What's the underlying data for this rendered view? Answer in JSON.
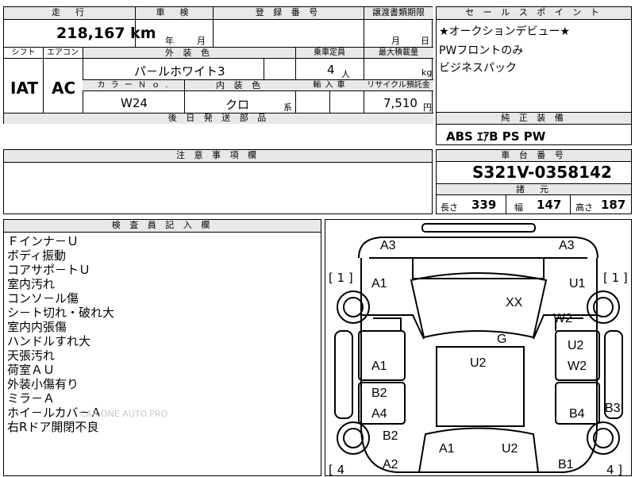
{
  "top_table": {
    "mileage_label": "走　行",
    "mileage_value": "218,167 km",
    "inspection_label": "車　検",
    "inspection_year_label": "年",
    "inspection_month_label": "月",
    "registration_label": "登 録 番 号",
    "transfer_deadline_label": "譲渡書類期限",
    "transfer_month_label": "月",
    "transfer_day_label": "日",
    "shift_label": "シフト",
    "shift_value": "IAT",
    "aircon_label": "エアコン",
    "aircon_value": "AC",
    "exterior_color_label": "外 装 色",
    "exterior_color_value": "パ－ルホワイト3",
    "capacity_label": "乗車定員",
    "capacity_value": "4",
    "capacity_unit": "人",
    "max_load_label": "最大積載量",
    "max_load_unit": "kg",
    "color_no_label": "カ ラ ー Ｎ ｏ .",
    "color_no_value": "W24",
    "interior_color_label": "内 装 色",
    "interior_color_value": "クロ",
    "interior_suffix": "系",
    "import_label": "輸 入 車",
    "recycle_label": "リサイクル預託金",
    "recycle_value": "7,510",
    "recycle_unit": "円",
    "later_parts_label": "後 日 発 送 部 品"
  },
  "sales_points": {
    "title": "セ ー ル ス ポ イ ン ト",
    "lines": [
      "★オークションデビュー★",
      "PWフロントのみ",
      "ビジネスパック"
    ]
  },
  "genuine_equipment": {
    "title": "純 正 装 備",
    "value": "ABS ｴｱB PS PW"
  },
  "notes": {
    "title": "注 意 事 項 欄"
  },
  "chassis": {
    "title": "車 台 番 号",
    "value": "S321V-0358142",
    "spec_title": "諸　元",
    "length_label": "長さ",
    "length_value": "339",
    "width_label": "幅",
    "width_value": "147",
    "height_label": "高さ",
    "height_value": "187"
  },
  "inspector": {
    "title": "検 査 員 記 入 欄",
    "lines": [
      "Ｆインナ－Ｕ",
      "ボディ振動",
      "コアサポ－トＵ",
      "室内汚れ",
      "コンソ－ル傷",
      "シ－ト切れ・破れ大",
      "室内内張傷",
      "ハンドルすれ大",
      "天張汚れ",
      "荷室ＡＵ",
      "外装小傷有り",
      "ミラ－Ａ",
      "ホイ－ルカバ－Ａ",
      "右Rドア開閉不良"
    ],
    "watermark": "CAR.ONE AUTO.PRO"
  },
  "diagram": {
    "tire_left": "[ 1 ]",
    "tire_right": "[ 1 ]",
    "tire_left_bottom": "[ 4",
    "tire_right_bottom": "4 ]",
    "codes": {
      "a3_left": "A3",
      "a3_right": "A3",
      "a1_left_top": "A1",
      "u1_right": "U1",
      "xx": "XX",
      "w2_right": "W2",
      "g": "G",
      "u2_right": "U2",
      "a1_left_mid": "A1",
      "u2_center": "U2",
      "w2_right_mid": "W2",
      "b2_left": "B2",
      "a4_left": "A4",
      "b4_right": "B4",
      "b3_right": "B3",
      "b2_left_low": "B2",
      "a1_bottom": "A1",
      "u2_bottom": "U2",
      "a2_left": "A2",
      "b1_right": "B1"
    }
  }
}
